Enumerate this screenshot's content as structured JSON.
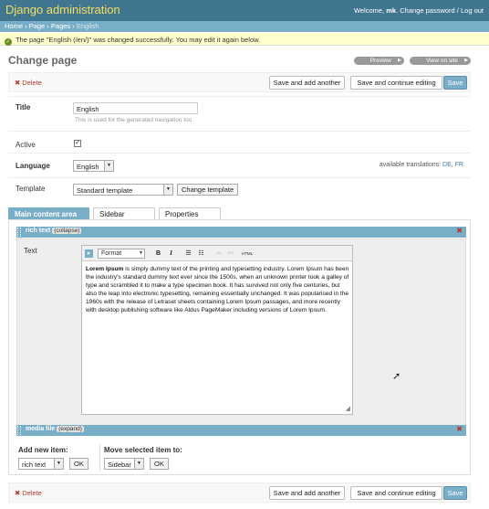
{
  "header": {
    "brand": "Django administration",
    "welcome": "Welcome,",
    "username": "mk",
    "links": "Change password / Log out"
  },
  "breadcrumbs": {
    "home": "Home",
    "page_app": "Page",
    "pages": "Pages",
    "current": "English"
  },
  "message": {
    "text": "The page \"English (/en/)\" was changed successfully. You may edit it again below.",
    "icon": "check-icon"
  },
  "title": "Change page",
  "object_tools": {
    "preview": "Preview",
    "view_on_site": "View on site"
  },
  "submit_row": {
    "delete": "Delete",
    "save_add": "Save and add another",
    "save_continue": "Save and continue editing",
    "save": "Save"
  },
  "form": {
    "title_label": "Title",
    "title_value": "English",
    "title_help": "This is used for the generated navigation too.",
    "active_label": "Active",
    "active_checked": true,
    "language_label": "Language",
    "language_value": "English",
    "translations_label": "available translations:",
    "translation_de": "DE",
    "translation_fr": "FR",
    "template_label": "Template",
    "template_value": "Standard template",
    "change_template": "Change template"
  },
  "tabs": [
    "Main content area",
    "Sidebar",
    "Properties"
  ],
  "plugins": {
    "rich_text_title": "rich text",
    "collapse": "collapse",
    "text_label": "Text",
    "format_select": "Format",
    "content_bold": "Lorem Ipsum",
    "content_rest": " is simply dummy text of the printing and typesetting industry. Lorem Ipsum has been the industry's standard dummy text ever since the 1500s, when an unknown printer took a galley of type and scrambled it to make a type specimen book. It has survived not only five centuries, but also the leap into electronic typesetting, remaining essentially unchanged. It was popularised in the 1960s with the release of Letraset sheets containing Lorem Ipsum passages, and more recently with desktop publishing software like Aldus PageMaker including versions of Lorem Ipsum.",
    "media_file_title": "media file",
    "expand": "expand"
  },
  "add_item": {
    "label": "Add new item:",
    "value": "rich text",
    "ok": "OK"
  },
  "move_item": {
    "label": "Move selected item to:",
    "value": "Sidebar",
    "ok": "OK"
  },
  "colors": {
    "header": "#417690",
    "breadcrumbs": "#79aec8",
    "accent": "#79aec8",
    "delete": "#b53b2e",
    "message_bg": "#ffffcc"
  }
}
